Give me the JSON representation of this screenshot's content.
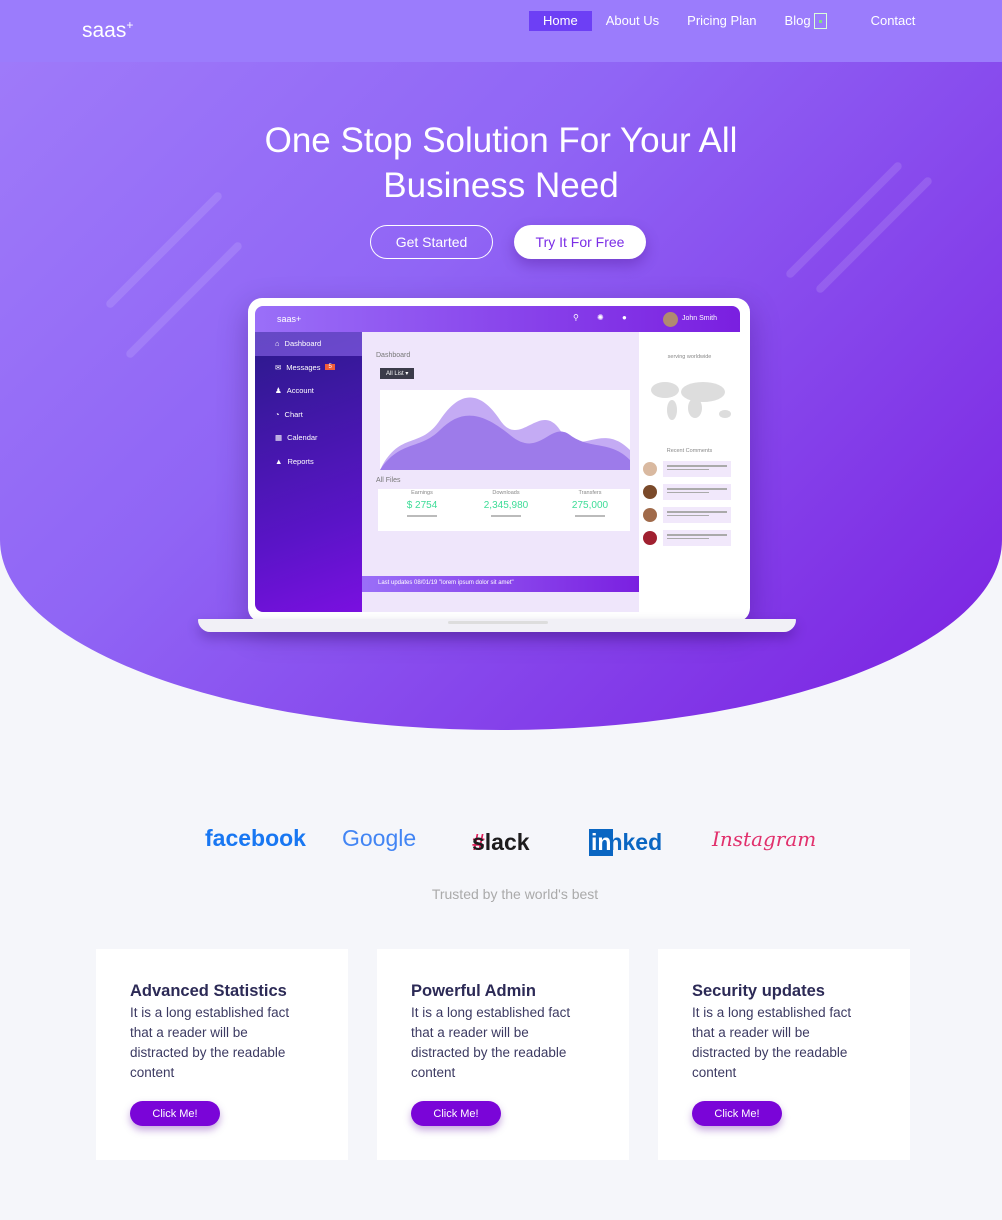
{
  "header": {
    "logo": "saas",
    "logo_sup": "+",
    "nav": [
      "Home",
      "About Us",
      "Pricing Plan",
      "Blog",
      "Contact"
    ],
    "active": "Home"
  },
  "hero": {
    "title_line1": "One Stop Solution For Your All",
    "title_line2": "Business Need",
    "get_started": "Get Started",
    "try_free": "Try It For Free"
  },
  "mockup": {
    "logo": "saas+",
    "user": "John Smith",
    "sidebar": [
      "Dashboard",
      "Messages",
      "Account",
      "Chart",
      "Calendar",
      "Reports"
    ],
    "messages_badge": "5",
    "title": "Dashboard",
    "dropdown": "All List ▾",
    "files_title": "All Files",
    "stats": [
      {
        "label": "Earnings",
        "value": "$ 2754"
      },
      {
        "label": "Downloads",
        "value": "2,345,980"
      },
      {
        "label": "Transfers",
        "value": "275,000"
      }
    ],
    "footer": "Last updates 08/01/19 \"lorem ipsum dolor sit amet\"",
    "serving": "serving worldwide",
    "recent": "Recent Comments"
  },
  "brands": [
    "facebook",
    "Google",
    "slack",
    "Linked",
    "in",
    "Instagram"
  ],
  "brand_colors": {
    "facebook": "#1877f2",
    "linkedin": "#0a66c2",
    "slack": "#1d1c1d"
  },
  "trusted": "Trusted by the world's best",
  "cards": [
    {
      "title": "Advanced Statistics",
      "text": "It is a long established fact that a reader will be distracted by the readable content",
      "button": "Click Me!"
    },
    {
      "title": "Powerful Admin",
      "text": "It is a long established fact that a reader will be distracted by the readable content",
      "button": "Click Me!"
    },
    {
      "title": "Security updates",
      "text": "It is a long established fact that a reader will be distracted by the readable content",
      "button": "Click Me!"
    }
  ],
  "colors": {
    "accent": "#7a05d8",
    "nav_active": "#6d3ff5",
    "header": "#9b7cfc"
  }
}
